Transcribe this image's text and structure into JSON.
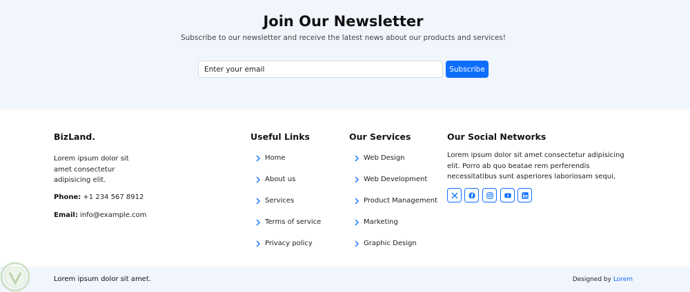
{
  "newsletter": {
    "title": "Join Our Newsletter",
    "subtitle": "Subscribe to our newsletter and receive the latest news about our products and services!",
    "email_placeholder": "Enter your email",
    "subscribe_label": "Subscribe"
  },
  "brand": {
    "name": "BizLand.",
    "about": "Lorem ipsum dolor sit amet consectetur adipisicing elit.",
    "phone_label": "Phone:",
    "phone": "+1 234 567 8912",
    "email_label": "Email:",
    "email": "info@example.com"
  },
  "useful_links": {
    "heading": "Useful Links",
    "items": [
      "Home",
      "About us",
      "Services",
      "Terms of service",
      "Privacy policy"
    ]
  },
  "services": {
    "heading": "Our Services",
    "items": [
      "Web Design",
      "Web Development",
      "Product Management",
      "Marketing",
      "Graphic Design"
    ]
  },
  "social": {
    "heading": "Our Social Networks",
    "text": "Lorem ipsum dolor sit amet consectetur adipisicing elit. Porro ab quo beatae rem perferendis necessitatibus sunt asperiores laboriosam sequi,",
    "icons": [
      "x-twitter-icon",
      "facebook-icon",
      "instagram-icon",
      "youtube-icon",
      "linkedin-icon"
    ]
  },
  "bottom": {
    "copyright": "Lorem ipsum dolor sit amet.",
    "designed_by_label": "Designed by",
    "designed_by_link": "Lorem"
  },
  "colors": {
    "accent": "#0d6efd",
    "light_bg": "#f1f5fc",
    "text": "#212529"
  }
}
